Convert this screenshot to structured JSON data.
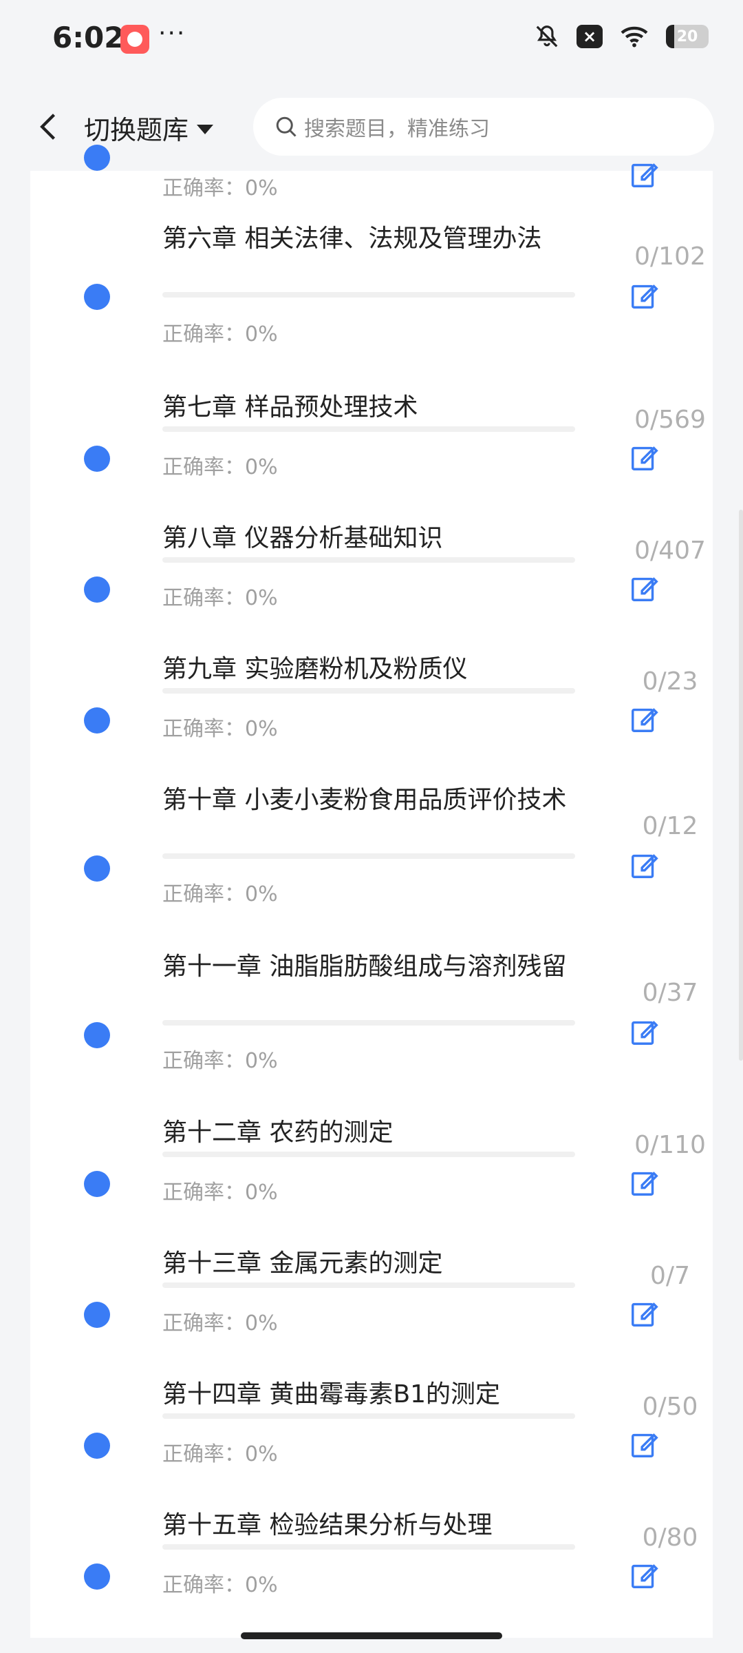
{
  "status": {
    "time": "6:02",
    "dots": "···",
    "battery": "20"
  },
  "header": {
    "title": "切换题库",
    "search_placeholder": "搜索题目，精准练习"
  },
  "accuracy_prefix": "正确率：",
  "chapters": [
    {
      "title": "",
      "accuracy": "0%",
      "count": ""
    },
    {
      "title": "第六章 相关法律、法规及管理办法",
      "accuracy": "0%",
      "count": "0/102"
    },
    {
      "title": "第七章 样品预处理技术",
      "accuracy": "0%",
      "count": "0/569"
    },
    {
      "title": "第八章 仪器分析基础知识",
      "accuracy": "0%",
      "count": "0/407"
    },
    {
      "title": "第九章 实验磨粉机及粉质仪",
      "accuracy": "0%",
      "count": "0/23"
    },
    {
      "title": "第十章 小麦小麦粉食用品质评价技术",
      "accuracy": "0%",
      "count": "0/12"
    },
    {
      "title": "第十一章 油脂脂肪酸组成与溶剂残留",
      "accuracy": "0%",
      "count": "0/37"
    },
    {
      "title": "第十二章 农药的测定",
      "accuracy": "0%",
      "count": "0/110"
    },
    {
      "title": "第十三章 金属元素的测定",
      "accuracy": "0%",
      "count": "0/7"
    },
    {
      "title": "第十四章 黄曲霉毒素B1的测定",
      "accuracy": "0%",
      "count": "0/50"
    },
    {
      "title": "第十五章 检验结果分析与处理",
      "accuracy": "0%",
      "count": "0/80"
    }
  ],
  "colors": {
    "accent": "#3a7cf5",
    "background": "#f4f5f7"
  }
}
